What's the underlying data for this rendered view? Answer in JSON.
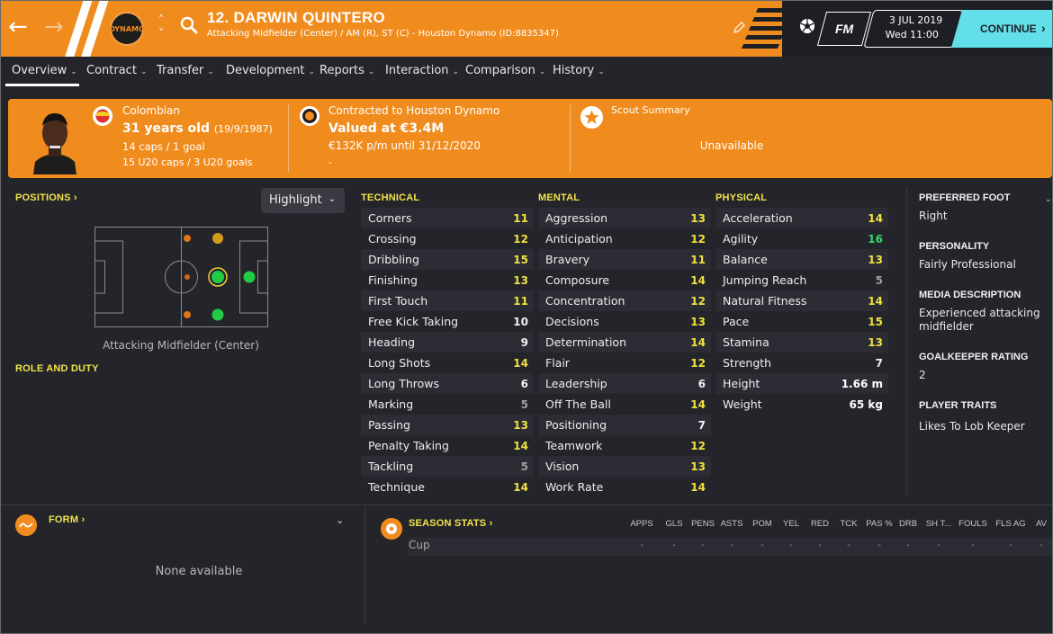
{
  "header": {
    "player_title": "12. DARWIN QUINTERO",
    "player_subtitle": "Attacking Midfielder (Center) / AM (R), ST (C) - Houston Dynamo (ID:8835347)",
    "club_badge_text": "DYNAMO",
    "back_icon": "back-arrow-icon",
    "forward_icon": "forward-arrow-icon",
    "fm_label": "FM",
    "date": "3 JUL 2019",
    "day_time": "Wed 11:00",
    "continue_label": "CONTINUE"
  },
  "tabs": [
    {
      "label": "Overview"
    },
    {
      "label": "Contract"
    },
    {
      "label": "Transfer"
    },
    {
      "label": "Development"
    },
    {
      "label": "Reports"
    },
    {
      "label": "Interaction"
    },
    {
      "label": "Comparison"
    },
    {
      "label": "History"
    }
  ],
  "banner": {
    "nationality": "Colombian",
    "age": "31 years old",
    "dob": "(19/9/1987)",
    "caps": "14 caps / 1 goal",
    "u20_caps": "15 U20 caps / 3 U20 goals",
    "contract": "Contracted to Houston Dynamo",
    "value": "Valued at €3.4M",
    "wage": "€132K p/m until 31/12/2020",
    "dash": "-",
    "scout_title": "Scout Summary",
    "scout_value": "Unavailable"
  },
  "left": {
    "positions_title": "POSITIONS",
    "highlight_label": "Highlight",
    "position_label": "Attacking Midfielder (Center)",
    "role_title": "ROLE AND DUTY"
  },
  "technical": {
    "title": "TECHNICAL",
    "rows": [
      {
        "name": "Corners",
        "value": "11",
        "color": "yellow"
      },
      {
        "name": "Crossing",
        "value": "12",
        "color": "yellow"
      },
      {
        "name": "Dribbling",
        "value": "15",
        "color": "yellow"
      },
      {
        "name": "Finishing",
        "value": "13",
        "color": "yellow"
      },
      {
        "name": "First Touch",
        "value": "11",
        "color": "yellow"
      },
      {
        "name": "Free Kick Taking",
        "value": "10",
        "color": "white"
      },
      {
        "name": "Heading",
        "value": "9",
        "color": "white"
      },
      {
        "name": "Long Shots",
        "value": "14",
        "color": "yellow"
      },
      {
        "name": "Long Throws",
        "value": "6",
        "color": "white"
      },
      {
        "name": "Marking",
        "value": "5",
        "color": "grey"
      },
      {
        "name": "Passing",
        "value": "13",
        "color": "yellow"
      },
      {
        "name": "Penalty Taking",
        "value": "14",
        "color": "yellow"
      },
      {
        "name": "Tackling",
        "value": "5",
        "color": "grey"
      },
      {
        "name": "Technique",
        "value": "14",
        "color": "yellow"
      }
    ]
  },
  "mental": {
    "title": "MENTAL",
    "rows": [
      {
        "name": "Aggression",
        "value": "13",
        "color": "yellow"
      },
      {
        "name": "Anticipation",
        "value": "12",
        "color": "yellow"
      },
      {
        "name": "Bravery",
        "value": "11",
        "color": "yellow"
      },
      {
        "name": "Composure",
        "value": "14",
        "color": "yellow"
      },
      {
        "name": "Concentration",
        "value": "12",
        "color": "yellow"
      },
      {
        "name": "Decisions",
        "value": "13",
        "color": "yellow"
      },
      {
        "name": "Determination",
        "value": "14",
        "color": "yellow"
      },
      {
        "name": "Flair",
        "value": "12",
        "color": "yellow"
      },
      {
        "name": "Leadership",
        "value": "6",
        "color": "white"
      },
      {
        "name": "Off The Ball",
        "value": "14",
        "color": "yellow"
      },
      {
        "name": "Positioning",
        "value": "7",
        "color": "white"
      },
      {
        "name": "Teamwork",
        "value": "12",
        "color": "yellow"
      },
      {
        "name": "Vision",
        "value": "13",
        "color": "yellow"
      },
      {
        "name": "Work Rate",
        "value": "14",
        "color": "yellow"
      }
    ]
  },
  "physical": {
    "title": "PHYSICAL",
    "rows": [
      {
        "name": "Acceleration",
        "value": "14",
        "color": "yellow"
      },
      {
        "name": "Agility",
        "value": "16",
        "color": "green"
      },
      {
        "name": "Balance",
        "value": "13",
        "color": "yellow"
      },
      {
        "name": "Jumping Reach",
        "value": "5",
        "color": "grey"
      },
      {
        "name": "Natural Fitness",
        "value": "14",
        "color": "yellow"
      },
      {
        "name": "Pace",
        "value": "15",
        "color": "yellow"
      },
      {
        "name": "Stamina",
        "value": "13",
        "color": "yellow"
      },
      {
        "name": "Strength",
        "value": "7",
        "color": "white"
      },
      {
        "name": "Height",
        "value": "1.66 m",
        "color": "plain"
      },
      {
        "name": "Weight",
        "value": "65 kg",
        "color": "plain"
      }
    ]
  },
  "info": {
    "foot_title": "PREFERRED FOOT",
    "foot_value": "Right",
    "personality_title": "PERSONALITY",
    "personality_value": "Fairly Professional",
    "media_title": "MEDIA DESCRIPTION",
    "media_value": "Experienced attacking midfielder",
    "gk_title": "GOALKEEPER RATING",
    "gk_value": "2",
    "traits_title": "PLAYER TRAITS",
    "traits_value": "Likes To Lob Keeper"
  },
  "form": {
    "title": "FORM",
    "empty": "None available"
  },
  "season": {
    "title": "SEASON STATS",
    "columns": [
      "APPS",
      "GLS",
      "PENS",
      "ASTS",
      "POM",
      "YEL",
      "RED",
      "TCK",
      "PAS %",
      "DRB",
      "SH T...",
      "FOULS",
      "FLS AG",
      "AV"
    ],
    "row_label": "Cup",
    "row_values": [
      "-",
      "-",
      "-",
      "-",
      "-",
      "-",
      "-",
      "-",
      "-",
      "-",
      "-",
      "-",
      "-",
      "-"
    ]
  },
  "colors": {
    "accent": "#f08c1e",
    "continue": "#63dfe9",
    "attr_yellow": "#f0e040",
    "attr_green": "#33d96a",
    "background": "#24252b"
  }
}
